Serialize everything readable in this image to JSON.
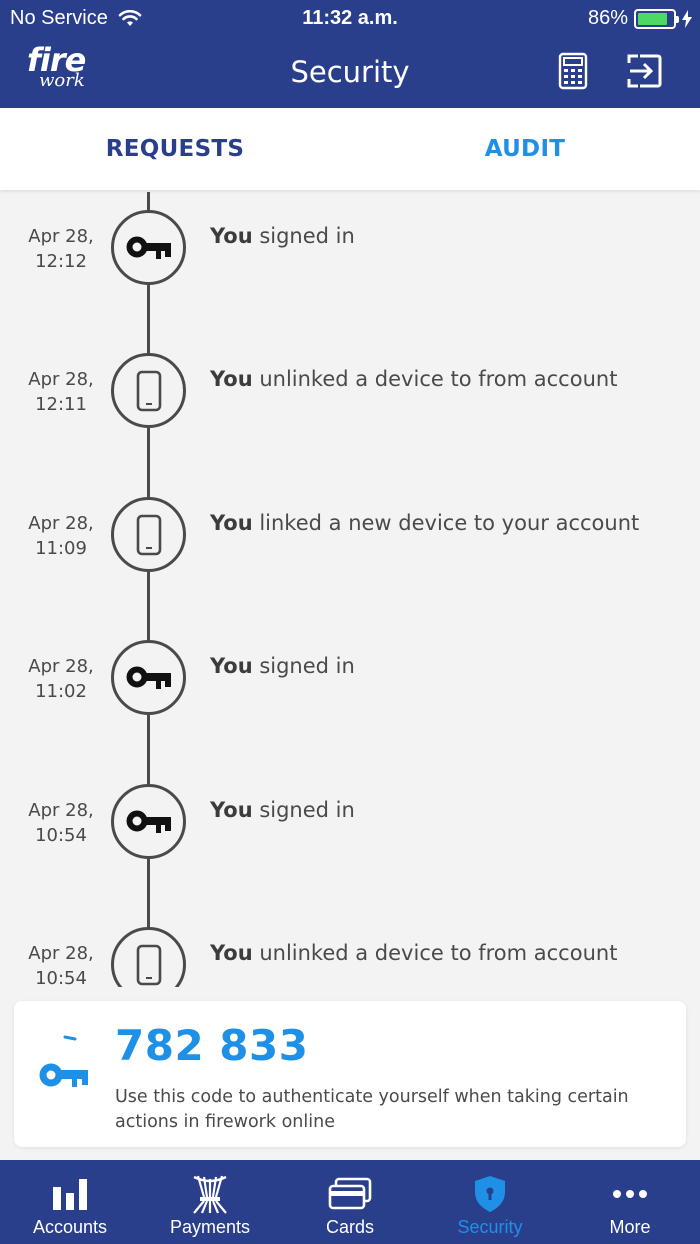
{
  "status_bar": {
    "carrier": "No Service",
    "time": "11:32 a.m.",
    "battery": "86%"
  },
  "header": {
    "logo_line1": "fire",
    "logo_line2": "work",
    "title": "Security"
  },
  "tabs": [
    {
      "label": "REQUESTS",
      "active": false
    },
    {
      "label": "AUDIT",
      "active": true
    }
  ],
  "audit": [
    {
      "date_line1": "Apr 28,",
      "date_line2": "12:12",
      "actor": "You",
      "action": " signed in",
      "icon": "key-icon"
    },
    {
      "date_line1": "Apr 28,",
      "date_line2": "12:11",
      "actor": "You",
      "action": " unlinked a device to from account",
      "icon": "phone-icon"
    },
    {
      "date_line1": "Apr 28,",
      "date_line2": "11:09",
      "actor": "You",
      "action": " linked a new device to your account",
      "icon": "phone-icon"
    },
    {
      "date_line1": "Apr 28,",
      "date_line2": "11:02",
      "actor": "You",
      "action": " signed in",
      "icon": "key-icon"
    },
    {
      "date_line1": "Apr 28,",
      "date_line2": "10:54",
      "actor": "You",
      "action": " signed in",
      "icon": "key-icon"
    },
    {
      "date_line1": "Apr 28,",
      "date_line2": "10:54",
      "actor": "You",
      "action": " unlinked a device to from account",
      "icon": "phone-icon"
    }
  ],
  "code_card": {
    "code": "782 833",
    "description": "Use this code to authenticate yourself when taking certain actions in firework online"
  },
  "bottom_nav": [
    {
      "label": "Accounts",
      "icon": "bar-chart-icon",
      "active": false
    },
    {
      "label": "Payments",
      "icon": "payments-icon",
      "active": false
    },
    {
      "label": "Cards",
      "icon": "cards-icon",
      "active": false
    },
    {
      "label": "Security",
      "icon": "shield-icon",
      "active": true
    },
    {
      "label": "More",
      "icon": "more-icon",
      "active": false
    }
  ],
  "colors": {
    "brand_navy": "#2a3f8c",
    "accent_blue": "#1e90e6",
    "battery_green": "#4cd964"
  }
}
